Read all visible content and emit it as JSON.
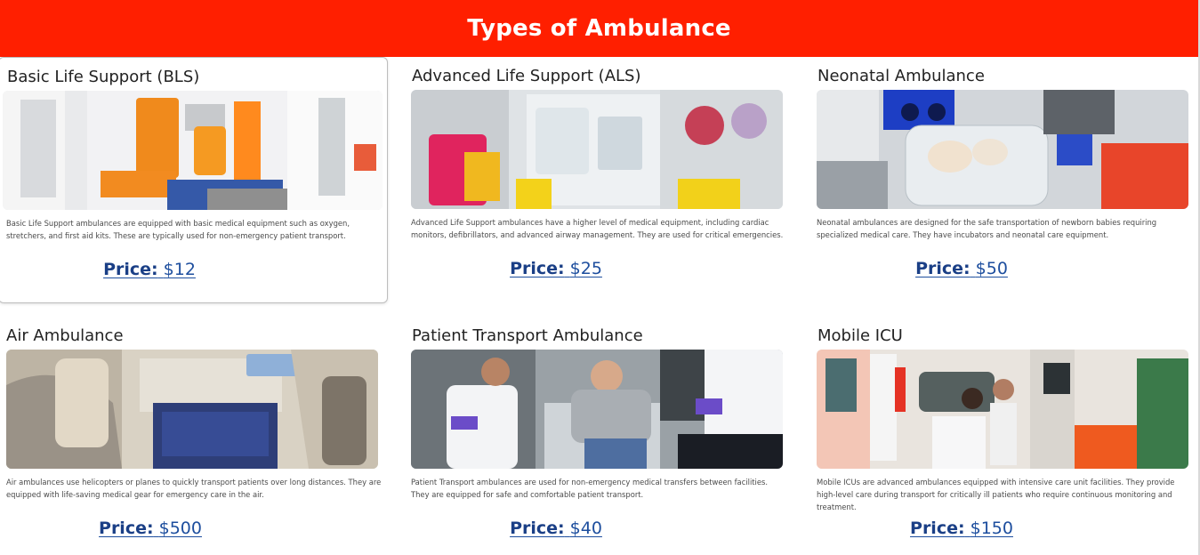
{
  "header": {
    "title": "Types of Ambulance"
  },
  "price_label": "Price:",
  "cards": [
    {
      "title": "Basic Life Support (BLS)",
      "image_alt": "Interior of a basic life support ambulance with orange seats",
      "description": "Basic Life Support ambulances are equipped with basic medical equipment such as oxygen, stretchers, and first aid kits. These are typically used for non-emergency patient transport.",
      "price": "$12"
    },
    {
      "title": "Advanced Life Support (ALS)",
      "image_alt": "Interior of an advanced life support ambulance with medical bags",
      "description": "Advanced Life Support ambulances have a higher level of medical equipment, including cardiac monitors, defibrillators, and advanced airway management. They are used for critical emergencies.",
      "price": "$25"
    },
    {
      "title": "Neonatal Ambulance",
      "image_alt": "Neonatal ambulance with incubator",
      "description": "Neonatal ambulances are designed for the safe transportation of newborn babies requiring specialized medical care. They have incubators and neonatal care equipment.",
      "price": "$50"
    },
    {
      "title": "Air Ambulance",
      "image_alt": "Interior of an air ambulance aircraft with stretcher",
      "description": "Air ambulances use helicopters or planes to quickly transport patients over long distances. They are equipped with life-saving medical gear for emergency care in the air.",
      "price": "$500"
    },
    {
      "title": "Patient Transport Ambulance",
      "image_alt": "Paramedics attending a patient inside an ambulance",
      "description": "Patient Transport ambulances are used for non-emergency medical transfers between facilities. They are equipped for safe and comfortable patient transport.",
      "price": "$40"
    },
    {
      "title": "Mobile ICU",
      "image_alt": "Mobile ICU ambulance with medical staff treating a patient",
      "description": "Mobile ICUs are advanced ambulances equipped with intensive care unit facilities. They provide high-level care during transport for critically ill patients who require continuous monitoring and treatment.",
      "price": "$150"
    }
  ],
  "colors": {
    "header_bg": "#ff1f00",
    "header_text": "#ffffff",
    "price_link": "#1d4e9e"
  }
}
